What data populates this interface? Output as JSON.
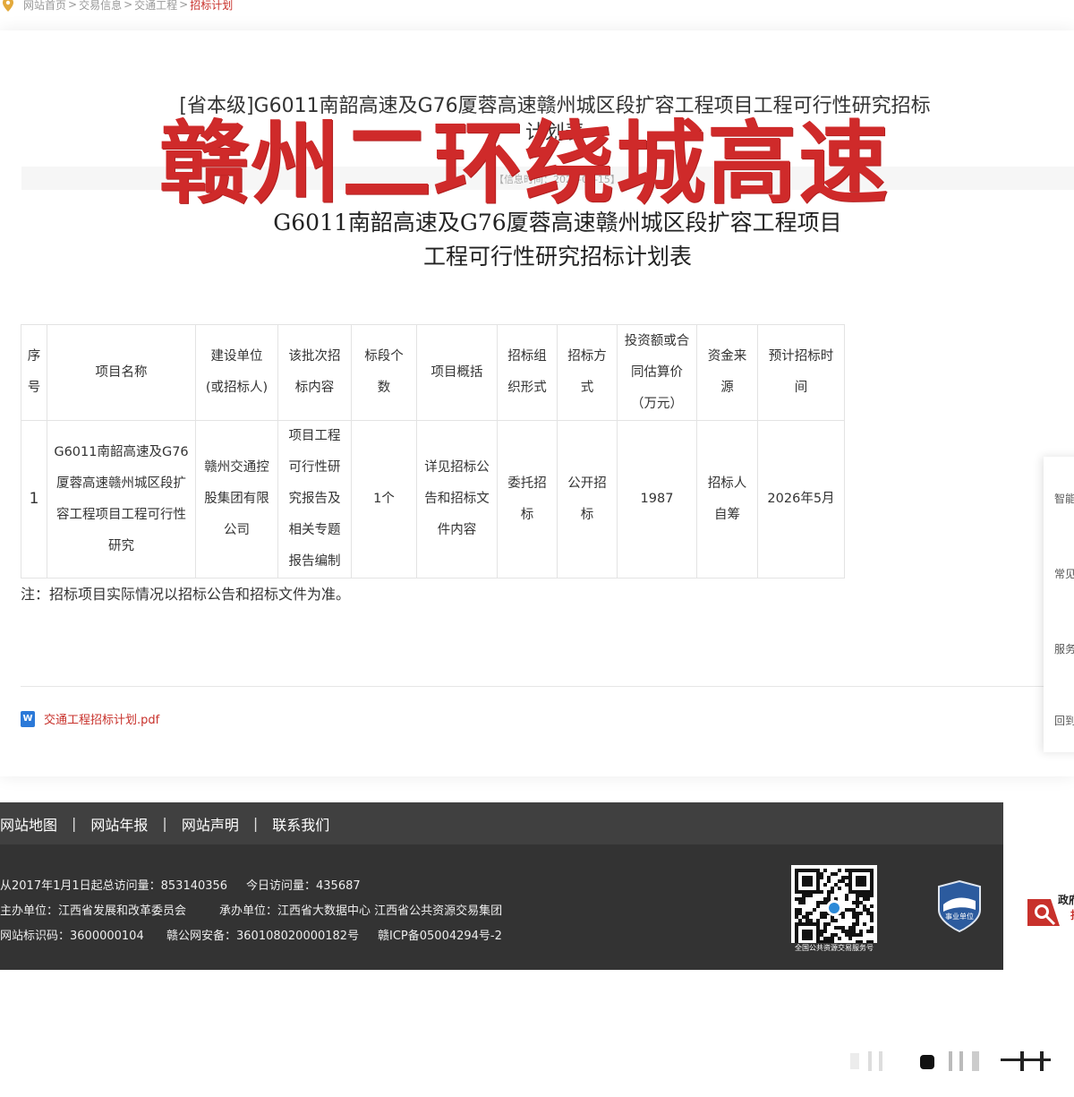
{
  "breadcrumb": {
    "home": "网站首页",
    "sep": ">",
    "level1": "交易信息",
    "level2": "交通工程",
    "current": "招标计划"
  },
  "article": {
    "title_line1": "[省本级]G6011南韶高速及G76厦蓉高速赣州城区段扩容工程项目工程可行性研究招标",
    "title_line2": "计划表",
    "date": "【信息时间：2026-04-15】",
    "overlay": "赣州二环绕城高速",
    "heading_line1": "G6011南韶高速及G76厦蓉高速赣州城区段扩容工程项目",
    "heading_line2": "工程可行性研究招标计划表"
  },
  "table": {
    "headers": [
      [
        "序",
        "号"
      ],
      [
        "项目名称"
      ],
      [
        "建设单位",
        "(或招标人)"
      ],
      [
        "该批次招",
        "标内容"
      ],
      [
        "标段个",
        "数"
      ],
      [
        "项目概括"
      ],
      [
        "招标组",
        "织形式"
      ],
      [
        "招标方",
        "式"
      ],
      [
        "投资额或合",
        "同估算价",
        "（万元）"
      ],
      [
        "资金来",
        "源"
      ],
      [
        "预计招标时",
        "间"
      ]
    ],
    "rows": [
      [
        [
          "1"
        ],
        [
          "G6011南韶高速及G76",
          "厦蓉高速赣州城区段扩",
          "容工程项目工程可行性",
          "研究"
        ],
        [
          "赣州交通控",
          "股集团有限",
          "公司"
        ],
        [
          "项目工程",
          "可行性研",
          "究报告及",
          "相关专题",
          "报告编制"
        ],
        [
          "1个"
        ],
        [
          "详见招标公",
          "告和招标文",
          "件内容"
        ],
        [
          "委托招",
          "标"
        ],
        [
          "公开招",
          "标"
        ],
        [
          "1987"
        ],
        [
          "招标人",
          "自筹"
        ],
        [
          "2026年5月"
        ]
      ]
    ]
  },
  "note": "注：招标项目实际情况以招标公告和招标文件为准。",
  "attachment": {
    "label": "交通工程招标计划.pdf",
    "icon": "word-doc-icon"
  },
  "side_panel": [
    "智能",
    "常见",
    "服务",
    "回到"
  ],
  "footer": {
    "nav": [
      "网站地图",
      "网站年报",
      "网站声明",
      "联系我们"
    ],
    "nav_sep": "|",
    "visits_total": "从2017年1月1日起总访问量：853140356",
    "visits_today": "今日访问量：435687",
    "sponsor": "主办单位：江西省发展和改革委员会",
    "operator": "承办单位：江西省大数据中心 江西省公共资源交易集团",
    "site_code": "网站标识码：3600000104",
    "police_record": "赣公网安备：360108020000182号",
    "icp": "赣ICP备05004294号-2",
    "qr_caption": "全国公共资源交易服务号",
    "badge_label": "事业单位",
    "gov_text_line1": "政府",
    "gov_text_line2": "找"
  },
  "colors": {
    "accent": "#c8312b",
    "overlay": "#cf2a2a",
    "footer_bg": "#333333",
    "footer_nav_bg": "#404040"
  }
}
